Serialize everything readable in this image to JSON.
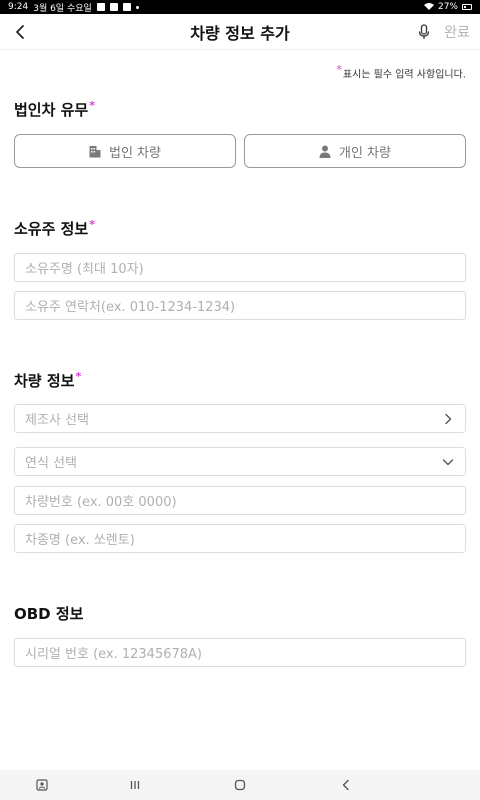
{
  "status_bar": {
    "time": "9:24",
    "date": "3월 6일 수요일",
    "battery": "27%"
  },
  "app_bar": {
    "title": "차량 정보 추가",
    "done_label": "완료"
  },
  "required_note": "표시는 필수 입력 사항입니다.",
  "sections": {
    "corporate": {
      "title": "법인차 유무",
      "options": [
        "법인 차량",
        "개인 차량"
      ]
    },
    "owner": {
      "title": "소유주 정보",
      "name_placeholder": "소유주명 (최대 10자)",
      "phone_placeholder": "소유주 연락처(ex. 010-1234-1234)"
    },
    "vehicle": {
      "title": "차량 정보",
      "manufacturer_placeholder": "제조사 선택",
      "year_placeholder": "연식 선택",
      "plate_placeholder": "차량번호 (ex. 00호 0000)",
      "model_placeholder": "차종명 (ex. 쏘렌토)"
    },
    "obd": {
      "title": "OBD 정보",
      "serial_placeholder": "시리얼 번호 (ex. 12345678A)"
    }
  },
  "colors": {
    "required_star": "#d33fd0",
    "border": "#dcdcdc",
    "placeholder": "#b0b0b0",
    "toggle_border": "#9a9a9a"
  }
}
